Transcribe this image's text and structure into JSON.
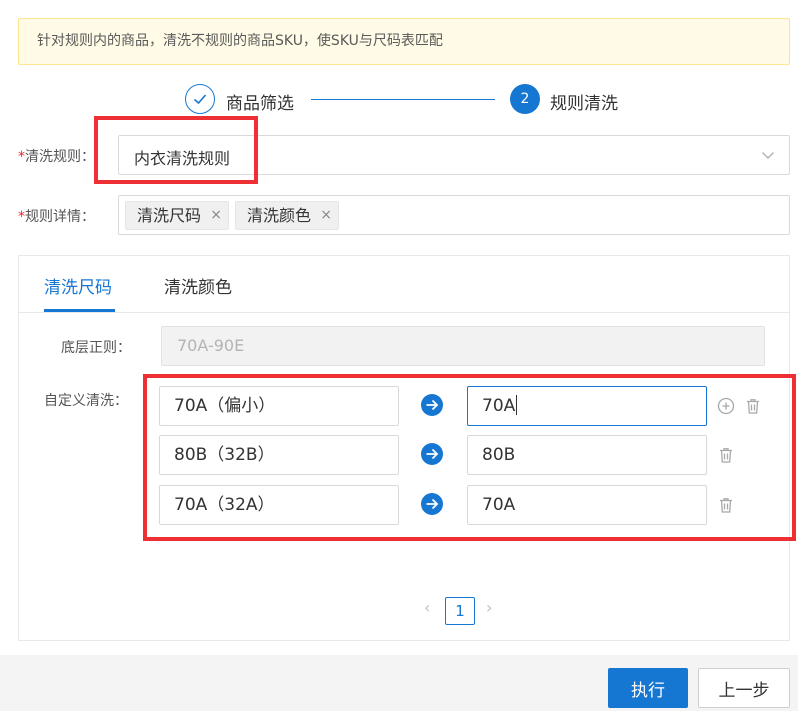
{
  "notice": {
    "text": "针对规则内的商品，清洗不规则的商品SKU，使SKU与尺码表匹配"
  },
  "steps": [
    {
      "index": "",
      "label": "商品筛选",
      "status": "done"
    },
    {
      "index": "2",
      "label": "规则清洗",
      "status": "current"
    }
  ],
  "form": {
    "rule": {
      "required_mark": "*",
      "label": "清洗规则：",
      "value": "内衣清洗规则"
    },
    "details": {
      "required_mark": "*",
      "label": "规则详情：",
      "tags": [
        {
          "label": "清洗尺码",
          "close": "×"
        },
        {
          "label": "清洗颜色",
          "close": "×"
        }
      ]
    }
  },
  "tabs": [
    {
      "label": "清洗尺码",
      "active": true
    },
    {
      "label": "清洗颜色",
      "active": false
    }
  ],
  "size_tab": {
    "base_regex_label": "底层正则：",
    "base_regex_value": "70A-90E",
    "custom_label": "自定义清洗：",
    "rows": [
      {
        "from": "70A（偏小）",
        "to": "70A"
      },
      {
        "from": "80B（32B）",
        "to": "80B"
      },
      {
        "from": "70A（32A）",
        "to": "70A"
      }
    ]
  },
  "pagination": {
    "prev": "‹",
    "current": "1",
    "next": "›"
  },
  "footer": {
    "execute_label": "执行",
    "prev_step_label": "上一步"
  },
  "colors": {
    "primary": "#1677d2",
    "highlight": "#ee2f33",
    "notice_bg": "#fffbe6"
  },
  "icons": [
    "check-icon",
    "chevron-down-icon",
    "arrow-right-icon",
    "add-circle-icon",
    "trash-icon",
    "close-icon"
  ]
}
